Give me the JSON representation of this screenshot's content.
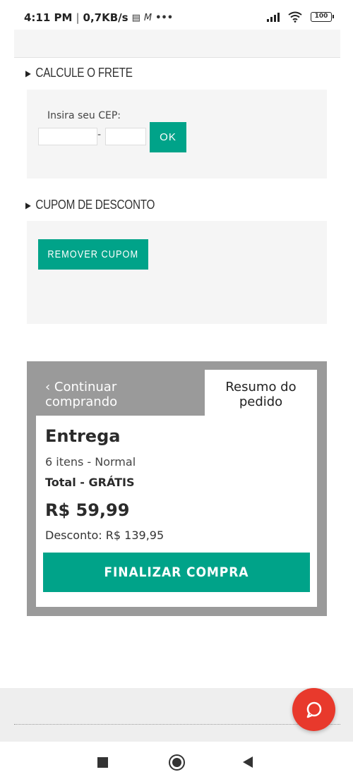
{
  "status_bar": {
    "time": "4:11 PM",
    "network_speed": "0,7KB/s",
    "extra_icons": [
      "calendar-icon",
      "m-icon",
      "more-icon"
    ],
    "battery": "100"
  },
  "shipping": {
    "title": "CALCULE O FRETE",
    "cep_label": "Insira seu CEP:",
    "cep_part1_value": "",
    "cep_part2_value": "",
    "dash": "-",
    "ok_label": "OK"
  },
  "coupon": {
    "title": "CUPOM DE DESCONTO",
    "remove_label": "REMOVER CUPOM"
  },
  "summary": {
    "continue_line1": "‹ Continuar",
    "continue_line2": "comprando",
    "resume_line1": "Resumo do",
    "resume_line2": "pedido",
    "delivery_title": "Entrega",
    "items": "6 itens - Normal",
    "total": "Total - GRÁTIS",
    "price": "R$ 59,99",
    "discount": "Desconto: R$ 139,95",
    "finalize_label": "FINALIZAR COMPRA"
  },
  "colors": {
    "accent": "#00a389",
    "chat": "#e8392c",
    "panel_grey": "#9a9a9a",
    "box_grey": "#f5f5f5"
  }
}
